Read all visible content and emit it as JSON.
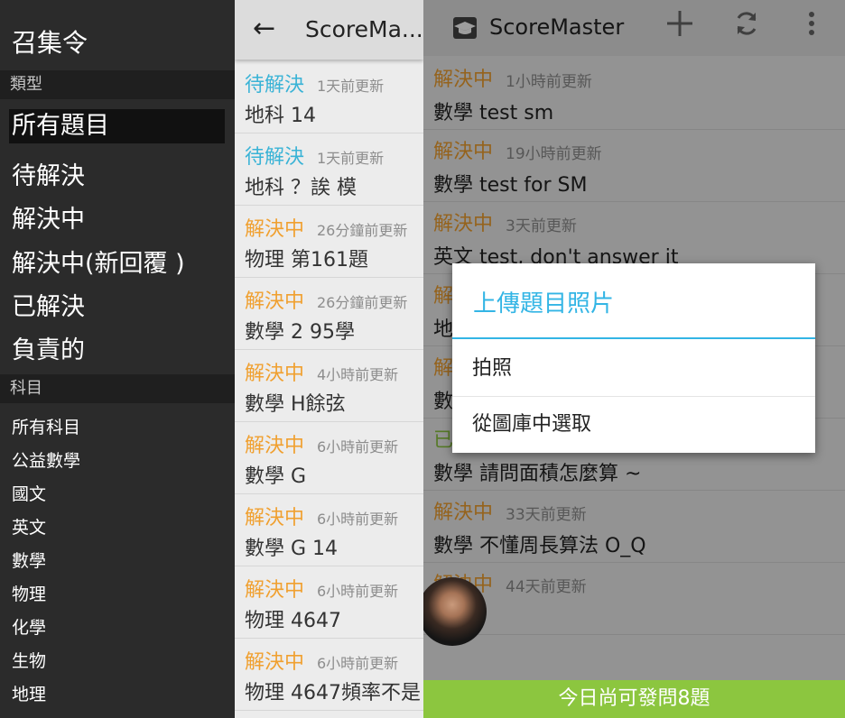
{
  "drawer": {
    "title": "召集令",
    "section_type": "類型",
    "type_items": [
      "所有題目",
      "待解決",
      "解決中",
      "解決中(新回覆 )",
      "已解決",
      "負責的"
    ],
    "section_subject": "科目",
    "subject_items": [
      "所有科目",
      "公益數學",
      "國文",
      "英文",
      "數學",
      "物理",
      "化學",
      "生物",
      "地理"
    ]
  },
  "list": {
    "back": "←",
    "title": "ScoreMa...",
    "items": [
      {
        "status": "待解決",
        "kind": "pending",
        "time": "1天前更新",
        "text": "地科 14"
      },
      {
        "status": "待解決",
        "kind": "pending",
        "time": "1天前更新",
        "text": "地科 ？誒 模"
      },
      {
        "status": "解決中",
        "kind": "solving",
        "time": "26分鐘前更新",
        "text": "物理 第161題"
      },
      {
        "status": "解決中",
        "kind": "solving",
        "time": "26分鐘前更新",
        "text": "數學 2  95學"
      },
      {
        "status": "解決中",
        "kind": "solving",
        "time": "4小時前更新",
        "text": "數學 H餘弦"
      },
      {
        "status": "解決中",
        "kind": "solving",
        "time": "6小時前更新",
        "text": "數學 G"
      },
      {
        "status": "解決中",
        "kind": "solving",
        "time": "6小時前更新",
        "text": "數學 G  14"
      },
      {
        "status": "解決中",
        "kind": "solving",
        "time": "6小時前更新",
        "text": "物理 4647"
      },
      {
        "status": "解決中",
        "kind": "solving",
        "time": "6小時前更新",
        "text": "物理 4647頻率不是"
      }
    ]
  },
  "main": {
    "app_title": "ScoreMaster",
    "add_icon": "plus-icon",
    "refresh_icon": "refresh-icon",
    "menu_icon": "more-vert-icon",
    "rows": [
      {
        "status": "解決中",
        "kind": "solving",
        "time": "1小時前更新",
        "text": "數學 test  sm"
      },
      {
        "status": "解決中",
        "kind": "solving",
        "time": "19小時前更新",
        "text": "數學 test for SM"
      },
      {
        "status": "解決中",
        "kind": "solving",
        "time": "3天前更新",
        "text": "英文 test, don't answer it"
      },
      {
        "status": "解",
        "kind": "solving",
        "time": "",
        "text": "地"
      },
      {
        "status": "解",
        "kind": "solving",
        "time": "",
        "text": "數"
      },
      {
        "status": "已",
        "kind": "solved",
        "time": "",
        "text": "數學 請問面積怎麼算 ~"
      },
      {
        "status": "解決中",
        "kind": "solving",
        "time": "33天前更新",
        "text": "數學 不懂周長算法 O_Q"
      },
      {
        "status": "解決中",
        "kind": "solving",
        "time": "44天前更新",
        "text": ""
      }
    ],
    "bottom_text": "今日尚可發問8題",
    "dialog": {
      "title": "上傳題目照片",
      "option_camera": "拍照",
      "option_gallery": "從圖庫中選取"
    },
    "colors": {
      "accent": "#33b5e5",
      "solving": "#f0a030",
      "pending": "#3ab3d6",
      "solved": "#8cc63f"
    }
  }
}
